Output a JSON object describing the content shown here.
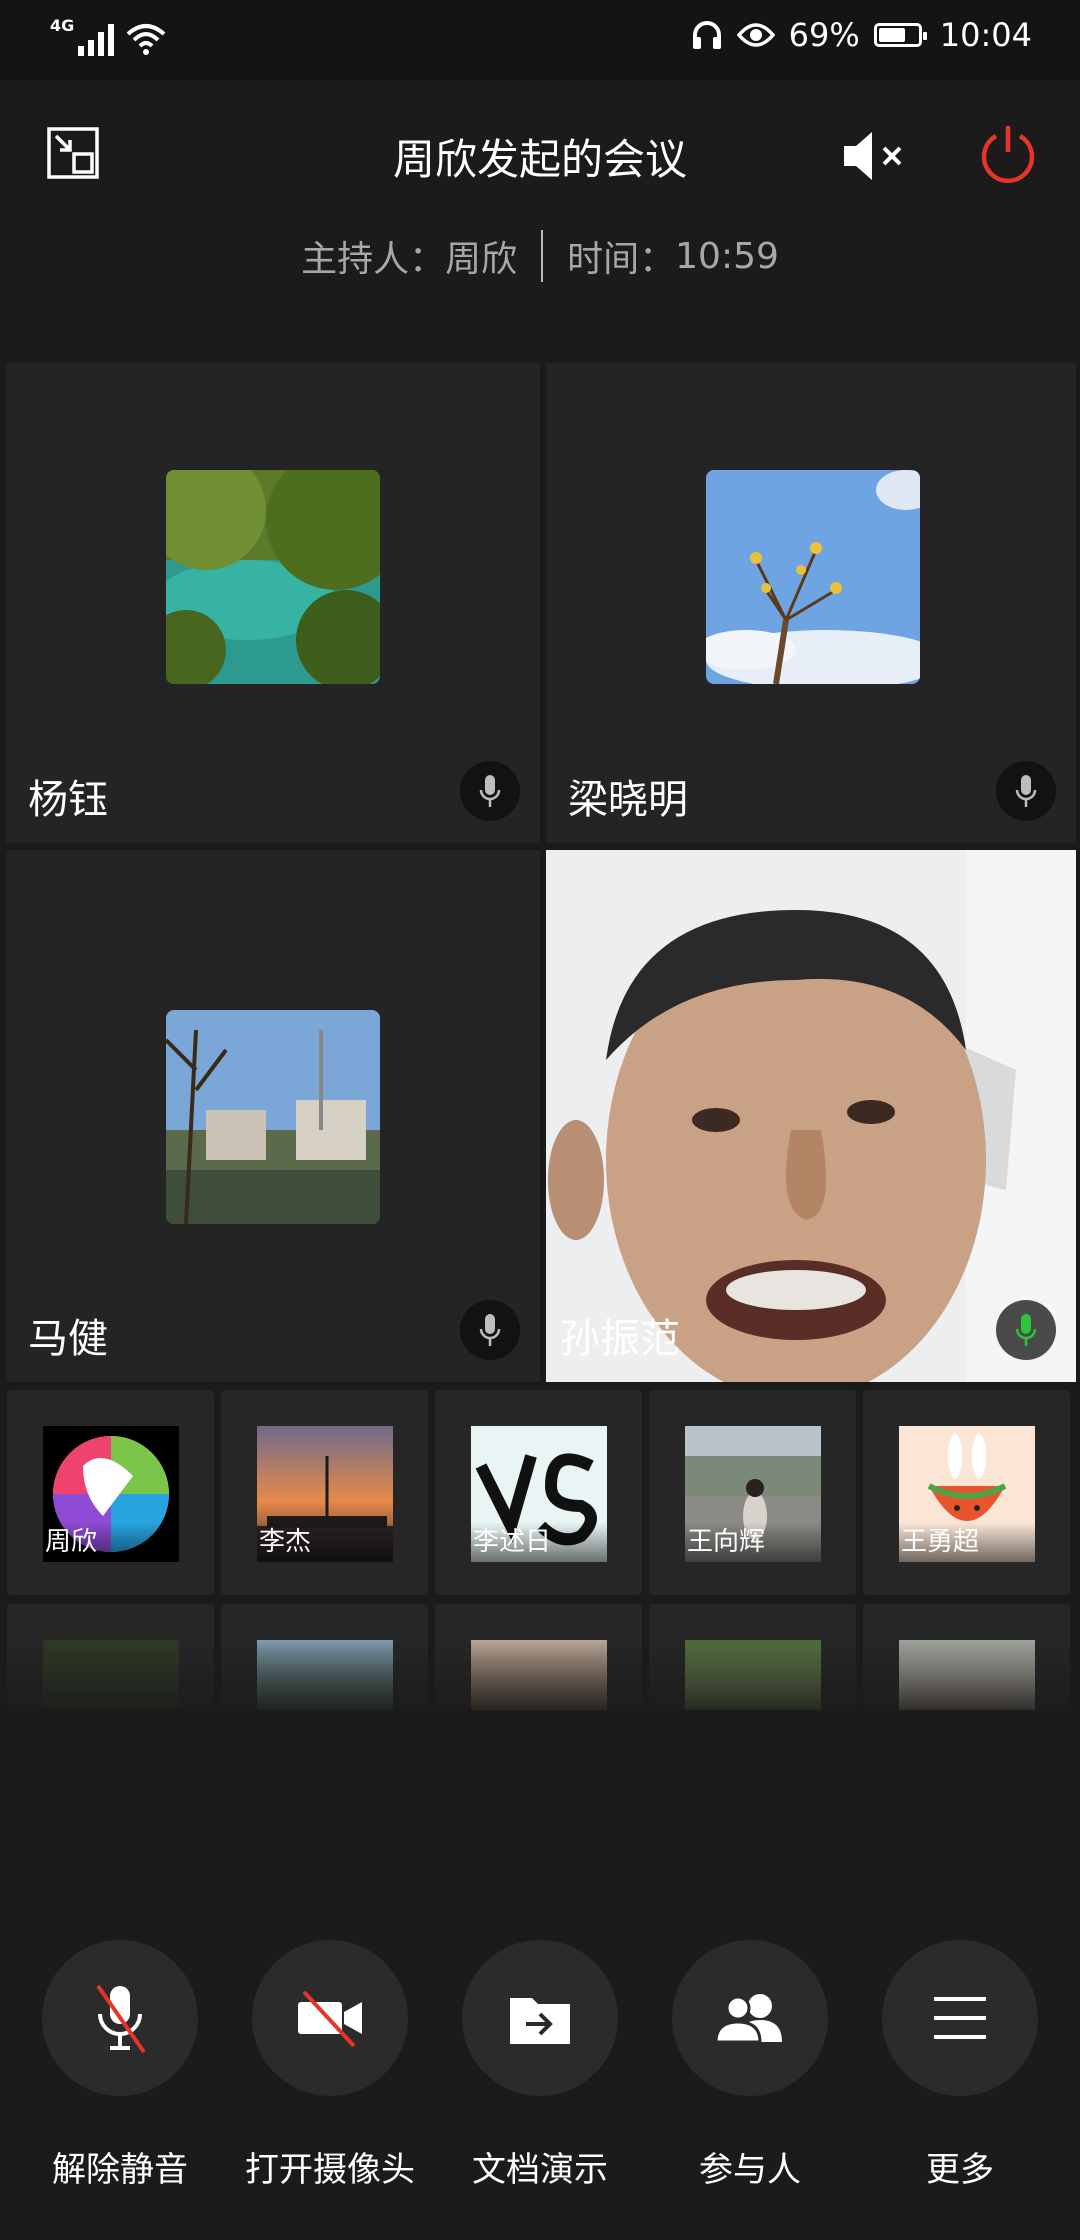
{
  "status_bar": {
    "network": "4G",
    "battery_percent": "69%",
    "battery_level": 0.69,
    "time": "10:04",
    "icons": [
      "signal-icon",
      "wifi-icon",
      "headphones-icon",
      "eye-icon",
      "battery-icon"
    ]
  },
  "header": {
    "title": "周欣发起的会议",
    "host_label": "主持人：",
    "host_name": "周欣",
    "time_label": "时间：",
    "time_value": "10:59"
  },
  "main_tiles": [
    {
      "name": "杨钰",
      "mic": "idle"
    },
    {
      "name": "梁晓明",
      "mic": "idle"
    },
    {
      "name": "马健",
      "mic": "idle"
    },
    {
      "name": "孙振范",
      "mic": "speaking"
    }
  ],
  "participants": [
    {
      "name": "周欣"
    },
    {
      "name": "李杰"
    },
    {
      "name": "李述日"
    },
    {
      "name": "王向辉"
    },
    {
      "name": "王勇超"
    }
  ],
  "controls": [
    {
      "label": "解除静音",
      "icon": "mic-off-icon"
    },
    {
      "label": "打开摄像头",
      "icon": "camera-off-icon"
    },
    {
      "label": "文档演示",
      "icon": "share-document-icon"
    },
    {
      "label": "参与人",
      "icon": "participants-icon"
    },
    {
      "label": "更多",
      "icon": "menu-icon"
    }
  ],
  "colors": {
    "power_red": "#e8332a",
    "speaking_green": "#2fc33a",
    "background": "#1b1b1b",
    "tile": "#242424"
  }
}
